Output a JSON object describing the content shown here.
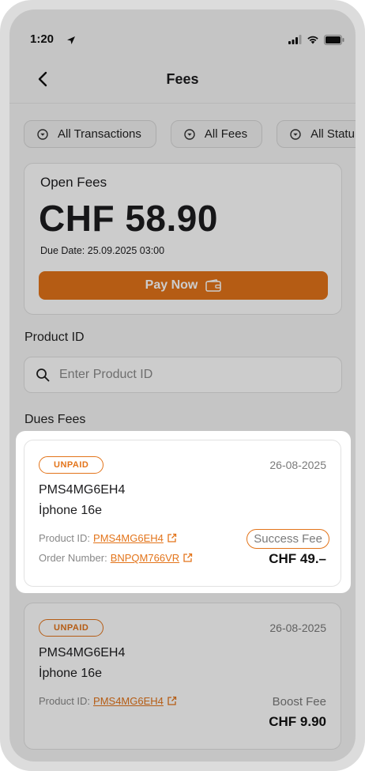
{
  "status_bar": {
    "time": "1:20"
  },
  "header": {
    "title": "Fees"
  },
  "filters": [
    {
      "label": "All Transactions"
    },
    {
      "label": "All Fees"
    },
    {
      "label": "All Statu"
    }
  ],
  "open_fees": {
    "label": "Open Fees",
    "amount": "CHF 58.90",
    "due_date": "Due Date: 25.09.2025 03:00",
    "pay_button": "Pay Now"
  },
  "product_search": {
    "label": "Product ID",
    "placeholder": "Enter Product ID"
  },
  "dues": {
    "label": "Dues Fees",
    "items": [
      {
        "status": "UNPAID",
        "date": "26-08-2025",
        "code": "PMS4MG6EH4",
        "name": "İphone 16e",
        "product_id_label": "Product ID:",
        "product_id": "PMS4MG6EH4",
        "order_label": "Order Number:",
        "order_number": "BNPQM766VR",
        "fee_type": "Success Fee",
        "amount": "CHF 49.–"
      },
      {
        "status": "UNPAID",
        "date": "26-08-2025",
        "code": "PMS4MG6EH4",
        "name": "İphone 16e",
        "product_id_label": "Product ID:",
        "product_id": "PMS4MG6EH4",
        "fee_type": "Boost Fee",
        "amount": "CHF 9.90"
      }
    ]
  },
  "colors": {
    "accent": "#e3741a"
  }
}
